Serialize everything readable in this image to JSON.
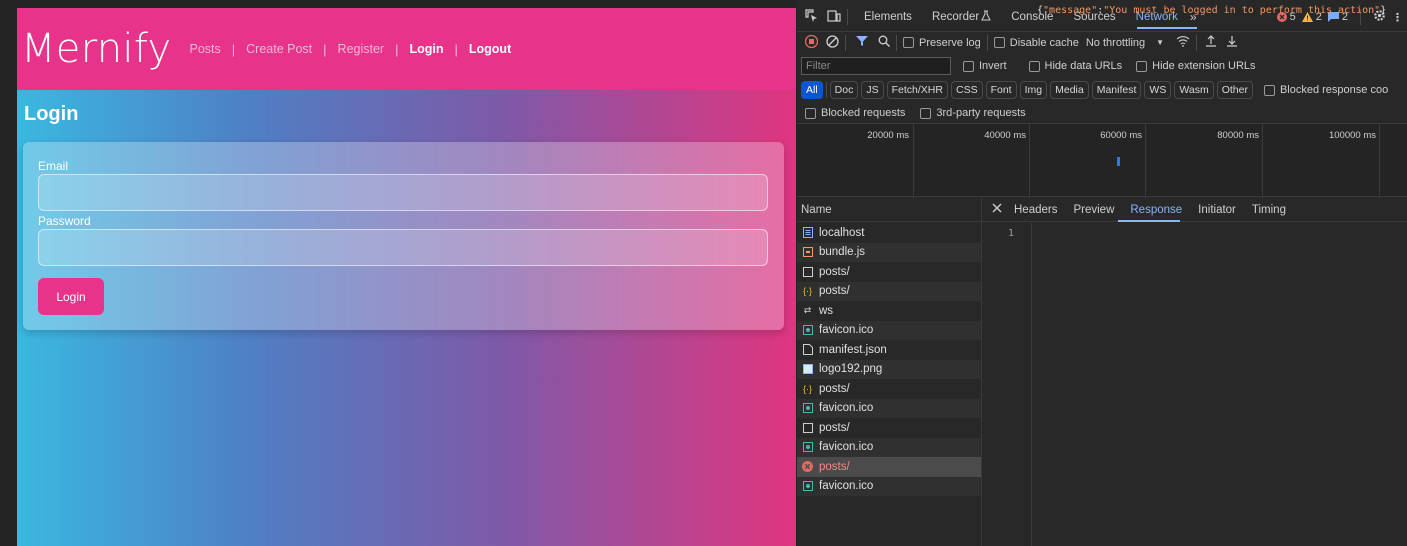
{
  "app": {
    "brand": "Mernify",
    "nav": [
      {
        "label": "Posts"
      },
      {
        "label": "Create Post"
      },
      {
        "label": "Register"
      },
      {
        "label": "Login"
      },
      {
        "label": "Logout"
      }
    ],
    "nav_separator": "|",
    "page_title": "Login",
    "form": {
      "email_label": "Email",
      "email_value": "",
      "password_label": "Password",
      "password_value": "",
      "submit_label": "Login"
    },
    "colors": {
      "navbar": "#e8338a",
      "button": "#e8338a"
    }
  },
  "devtools": {
    "tabs": [
      "Elements",
      "Recorder",
      "Console",
      "Sources",
      "Network"
    ],
    "active_tab": "Network",
    "counts": {
      "errors": "5",
      "warnings": "2",
      "messages": "2"
    },
    "toolbar": {
      "preserve_log": "Preserve log",
      "disable_cache": "Disable cache",
      "throttling": "No throttling"
    },
    "filter": {
      "placeholder": "Filter",
      "invert": "Invert",
      "hide_data_urls": "Hide data URLs",
      "hide_extension_urls": "Hide extension URLs"
    },
    "types": [
      "All",
      "Doc",
      "JS",
      "Fetch/XHR",
      "CSS",
      "Font",
      "Img",
      "Media",
      "Manifest",
      "WS",
      "Wasm",
      "Other"
    ],
    "blocked_response_cookies": "Blocked response coo",
    "blocked_requests": "Blocked requests",
    "third_party_requests": "3rd-party requests",
    "timeline_ticks": [
      "20000 ms",
      "40000 ms",
      "60000 ms",
      "80000 ms",
      "100000 ms"
    ],
    "name_header": "Name",
    "requests": [
      {
        "name": "localhost",
        "icon": "doc-icon",
        "status": "ok"
      },
      {
        "name": "bundle.js",
        "icon": "script-icon",
        "status": "ok"
      },
      {
        "name": "posts/",
        "icon": "blank-icon",
        "status": "ok"
      },
      {
        "name": "posts/",
        "icon": "json-icon",
        "status": "ok"
      },
      {
        "name": "ws",
        "icon": "websocket-icon",
        "status": "ok"
      },
      {
        "name": "favicon.ico",
        "icon": "image-icon",
        "status": "ok"
      },
      {
        "name": "manifest.json",
        "icon": "file-icon",
        "status": "ok"
      },
      {
        "name": "logo192.png",
        "icon": "image-icon",
        "status": "ok"
      },
      {
        "name": "posts/",
        "icon": "json-icon",
        "status": "ok"
      },
      {
        "name": "favicon.ico",
        "icon": "image-icon",
        "status": "ok"
      },
      {
        "name": "posts/",
        "icon": "blank-icon",
        "status": "ok"
      },
      {
        "name": "favicon.ico",
        "icon": "image-icon",
        "status": "ok"
      },
      {
        "name": "posts/",
        "icon": "error-icon",
        "status": "error"
      },
      {
        "name": "favicon.ico",
        "icon": "image-icon",
        "status": "ok"
      }
    ],
    "detail_tabs": [
      "Headers",
      "Preview",
      "Response",
      "Initiator",
      "Timing"
    ],
    "active_detail_tab": "Response",
    "response": {
      "line_number": "1",
      "key": "\"message\"",
      "value": "\"You must be logged in to perform this action\""
    }
  }
}
